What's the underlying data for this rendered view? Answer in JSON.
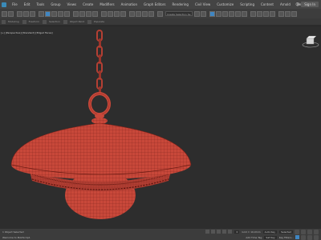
{
  "app": {
    "menus": [
      "File",
      "Edit",
      "Tools",
      "Group",
      "Views",
      "Create",
      "Modifiers",
      "Animation",
      "Graph Editors",
      "Rendering",
      "Civil View",
      "Customize",
      "Scripting",
      "Content",
      "Arnold",
      "Help"
    ],
    "signin_label": "Sign In"
  },
  "toolbar": {
    "selection_set": "Create Selection Se"
  },
  "ribbon": {
    "group_labels": [
      "Modeling",
      "Freeform",
      "Selection",
      "Object Paint",
      "Populate"
    ]
  },
  "viewport": {
    "label": "[+] [Perspective] [Standard] [Edged Faces]"
  },
  "status": {
    "left_top": "1 Object Selected",
    "left_bottom": "Welcome to MAXScript.",
    "grid": "Grid = 10,0mm",
    "add_time_tag": "Add Time Tag",
    "auto_key": "Auto Key",
    "selected": "Selected",
    "set_key": "Set Key",
    "key_filters": "Key Filters...",
    "frame": "0"
  },
  "colors": {
    "object": "#c8483a",
    "wire": "#6e1c14",
    "viewport_bg": "#2d2d2d",
    "accent": "#3f86c2"
  }
}
